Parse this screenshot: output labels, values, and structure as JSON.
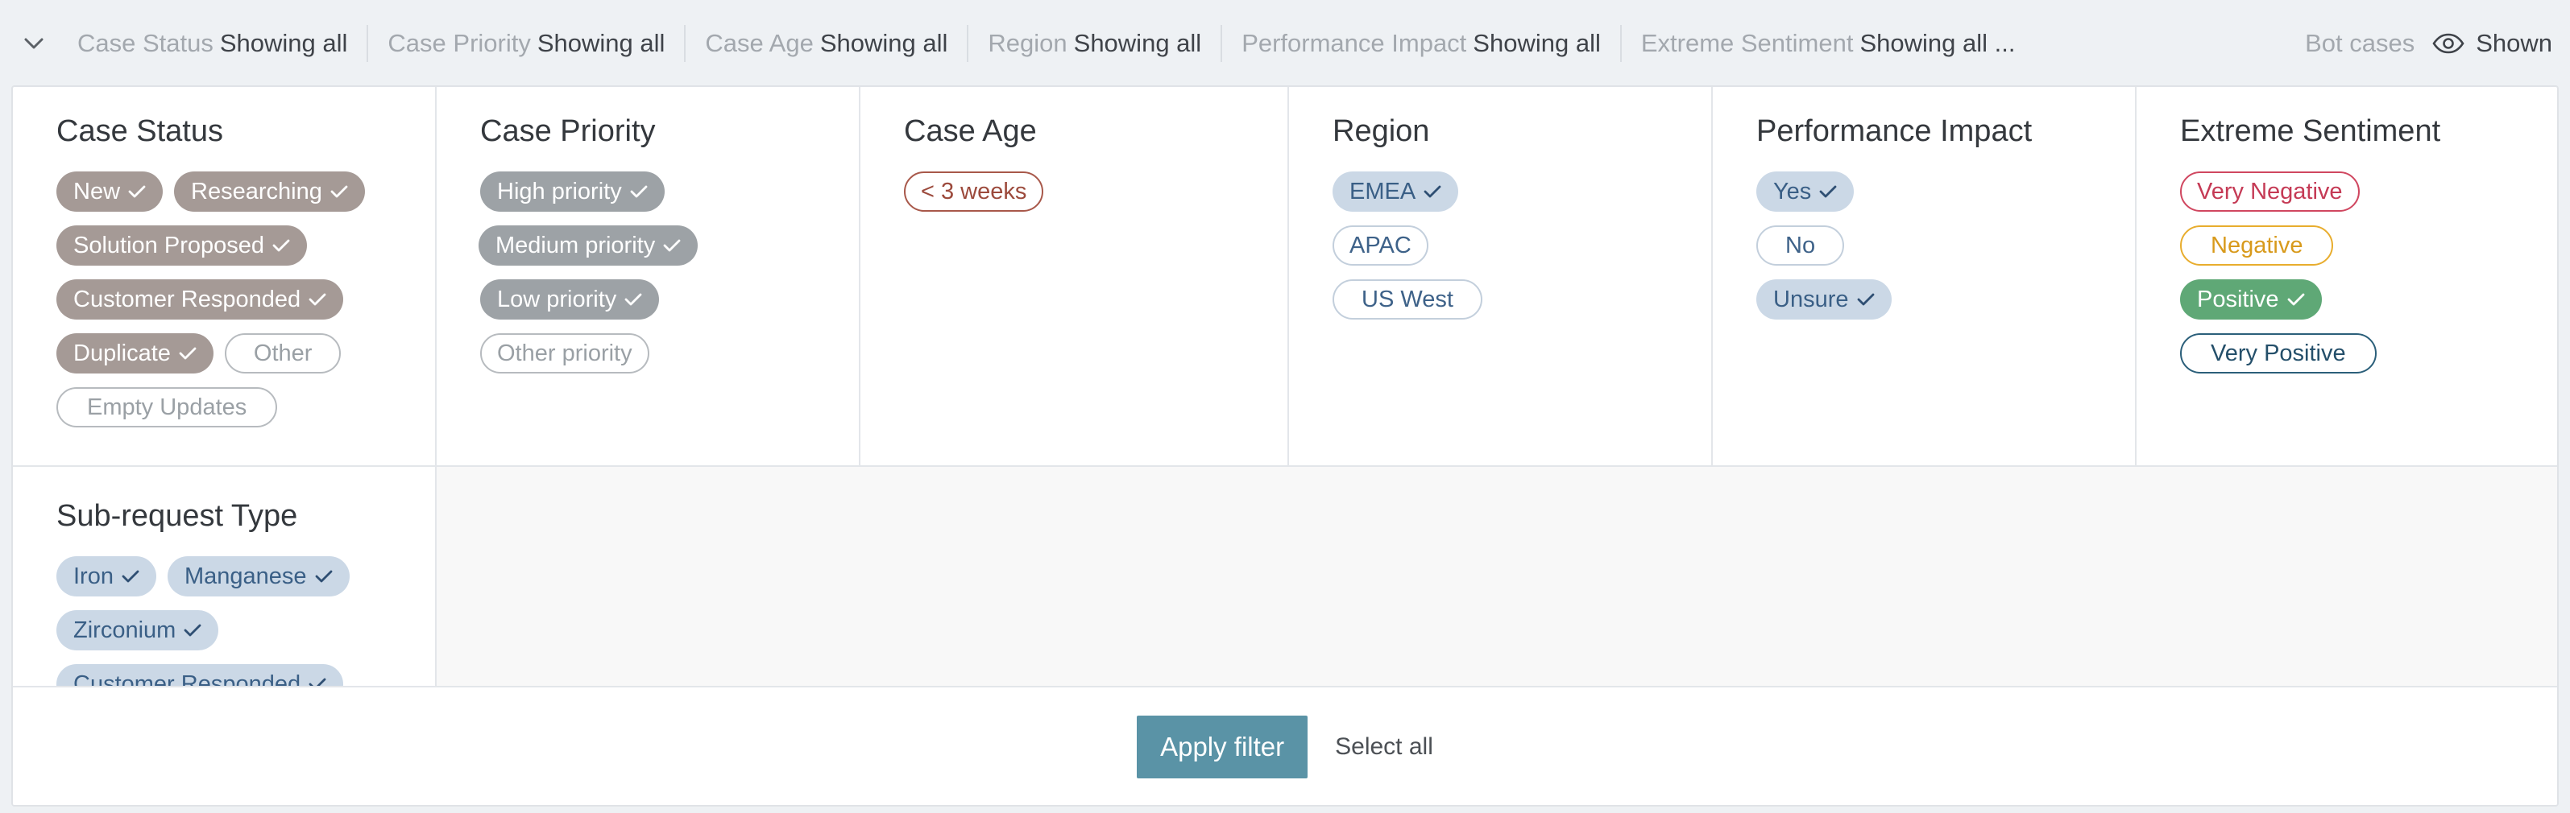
{
  "summary": {
    "items": [
      {
        "label": "Case Status",
        "value": "Showing all"
      },
      {
        "label": "Case Priority",
        "value": "Showing all"
      },
      {
        "label": "Case Age",
        "value": "Showing all"
      },
      {
        "label": "Region",
        "value": "Showing all"
      },
      {
        "label": "Performance Impact",
        "value": "Showing all"
      },
      {
        "label": "Extreme Sentiment",
        "value": "Showing all ..."
      }
    ],
    "bot_label": "Bot cases",
    "bot_value": "Shown"
  },
  "filters": {
    "case_status": {
      "title": "Case Status",
      "chips": [
        {
          "label": "New",
          "selected": true
        },
        {
          "label": "Researching",
          "selected": true
        },
        {
          "label": "Solution Proposed",
          "selected": true
        },
        {
          "label": "Customer Responded",
          "selected": true
        },
        {
          "label": "Duplicate",
          "selected": true
        },
        {
          "label": "Other",
          "selected": false
        },
        {
          "label": "Empty Updates",
          "selected": false
        }
      ]
    },
    "case_priority": {
      "title": "Case Priority",
      "chips": [
        {
          "label": "High priority",
          "selected": true
        },
        {
          "label": "Medium priority",
          "selected": true
        },
        {
          "label": "Low priority",
          "selected": true
        },
        {
          "label": "Other priority",
          "selected": false
        }
      ]
    },
    "case_age": {
      "title": "Case Age",
      "chips": [
        {
          "label": "< 3 weeks",
          "selected": false
        }
      ]
    },
    "region": {
      "title": "Region",
      "chips": [
        {
          "label": "EMEA",
          "selected": true
        },
        {
          "label": "APAC",
          "selected": false
        },
        {
          "label": "US West",
          "selected": false
        }
      ]
    },
    "performance_impact": {
      "title": "Performance Impact",
      "chips": [
        {
          "label": "Yes",
          "selected": true
        },
        {
          "label": "No",
          "selected": false
        },
        {
          "label": "Unsure",
          "selected": true
        }
      ]
    },
    "extreme_sentiment": {
      "title": "Extreme Sentiment",
      "chips": [
        {
          "label": "Very Negative",
          "selected": false
        },
        {
          "label": "Negative",
          "selected": false
        },
        {
          "label": "Positive",
          "selected": true
        },
        {
          "label": "Very Positive",
          "selected": false
        }
      ]
    },
    "sub_request_type": {
      "title": "Sub-request Type",
      "chips": [
        {
          "label": "Iron",
          "selected": true
        },
        {
          "label": "Manganese",
          "selected": true
        },
        {
          "label": "Zirconium",
          "selected": true
        },
        {
          "label": "Customer Responded",
          "selected": true
        }
      ]
    }
  },
  "footer": {
    "apply_label": "Apply filter",
    "select_all_label": "Select all"
  },
  "colors": {
    "selected_brown": "#a59a96",
    "selected_gray": "#9da2a6",
    "selected_blue": "#cbd8e6",
    "selected_green": "#5fa876",
    "very_negative": "#d04760",
    "negative": "#e8ad2e",
    "very_positive": "#2b5f7a",
    "case_age_outline": "#a8584a",
    "apply_button": "#5a93a6"
  }
}
